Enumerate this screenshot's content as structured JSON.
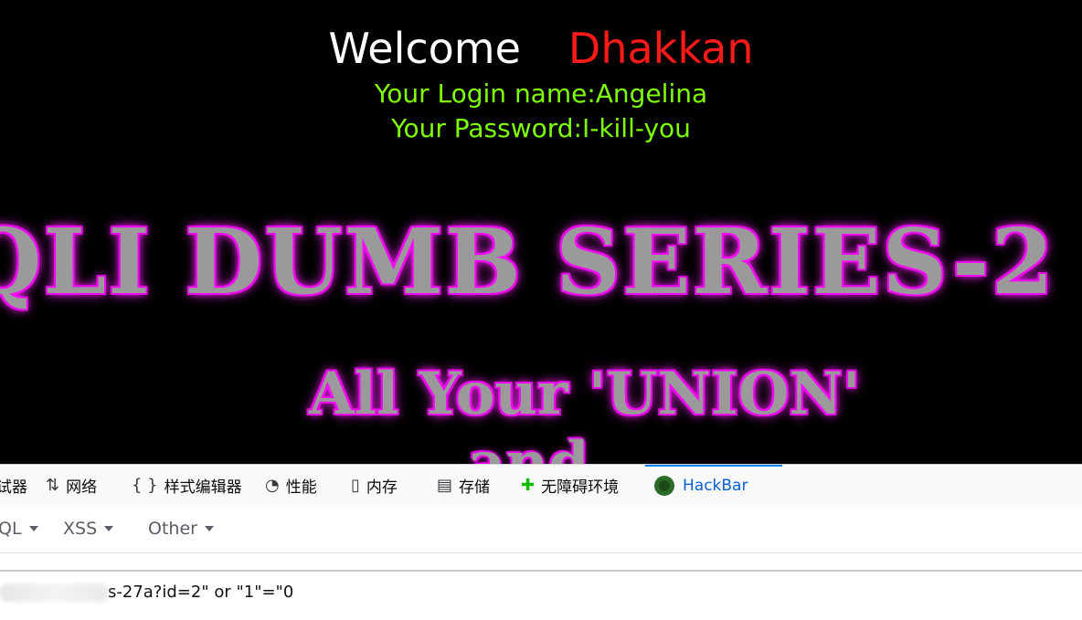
{
  "welcome": {
    "word": "Welcome",
    "user": "Dhakkan"
  },
  "login": {
    "name_line": "Your Login name:Angelina",
    "password_line": "Your Password:I-kill-you"
  },
  "banner": {
    "line1": "QLI DUMB SERIES-2 \"",
    "line2": "All Your 'UNION'",
    "line3": "and"
  },
  "devtools": {
    "tabs": [
      {
        "label": "试器",
        "icon": "debugger-icon"
      },
      {
        "label": "网络",
        "icon": "network-icon"
      },
      {
        "label": "样式编辑器",
        "icon": "style-editor-icon"
      },
      {
        "label": "性能",
        "icon": "performance-icon"
      },
      {
        "label": "内存",
        "icon": "memory-icon"
      },
      {
        "label": "存储",
        "icon": "storage-icon"
      },
      {
        "label": "无障碍环境",
        "icon": "accessibility-icon"
      },
      {
        "label": "HackBar",
        "icon": "hackbar-icon"
      }
    ],
    "menus": [
      {
        "label": "QL"
      },
      {
        "label": "XSS"
      },
      {
        "label": "Other"
      }
    ],
    "url_prefix": "",
    "url_suffix": "s-27a?id=2\" or \"1\"=\"0"
  },
  "colors": {
    "welcome": "#ffffff",
    "username": "#ff1a1a",
    "info": "#7fff00",
    "glow": "#ff00ff",
    "active_tab": "#0a5fd6"
  }
}
